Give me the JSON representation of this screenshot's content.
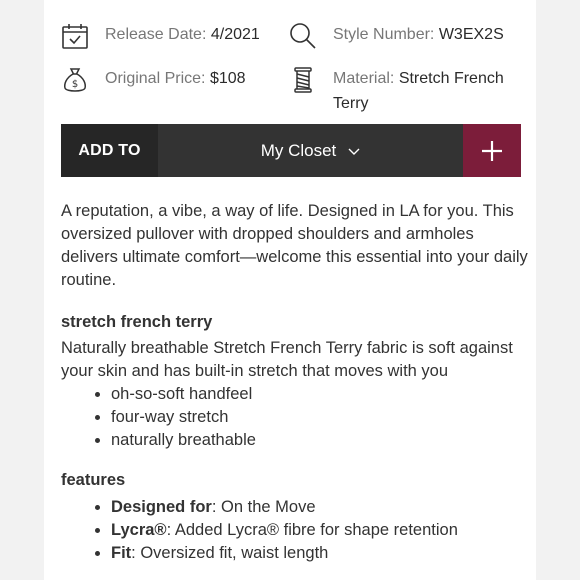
{
  "meta": {
    "release": {
      "label": "Release Date:",
      "value": "4/2021",
      "icon": "calendar-icon"
    },
    "style": {
      "label": "Style Number:",
      "value": "W3EX2S",
      "icon": "search-icon"
    },
    "price": {
      "label": "Original Price:",
      "value": "$108",
      "icon": "money-bag-icon"
    },
    "material": {
      "label": "Material:",
      "value_line1": "Stretch French",
      "value_line2": "Terry",
      "icon": "thread-spool-icon"
    }
  },
  "addbar": {
    "add_to_label": "ADD TO",
    "closet_label": "My Closet",
    "plus_icon": "plus-icon",
    "colors": {
      "add_to_bg": "#262626",
      "bar_bg": "#333333",
      "plus_bg": "#7c1d3a"
    }
  },
  "description": {
    "intro": "A reputation, a vibe, a way of life. Designed in LA for you. This oversized pullover with dropped shoulders and armholes delivers ultimate comfort—welcome this essential into your daily routine.",
    "fabric_title": "stretch french terry",
    "fabric_text": "Naturally breathable Stretch French Terry fabric is soft against your skin and has built-in stretch that moves with you",
    "fabric_bullets": [
      "oh-so-soft handfeel",
      "four-way stretch",
      "naturally breathable"
    ],
    "features_title": "features",
    "features": [
      {
        "label": "Designed for",
        "text": ": On the Move"
      },
      {
        "label": "Lycra®",
        "text": ": Added Lycra® fibre for shape retention"
      },
      {
        "label": "Fit",
        "text": ": Oversized fit, waist length"
      }
    ]
  }
}
